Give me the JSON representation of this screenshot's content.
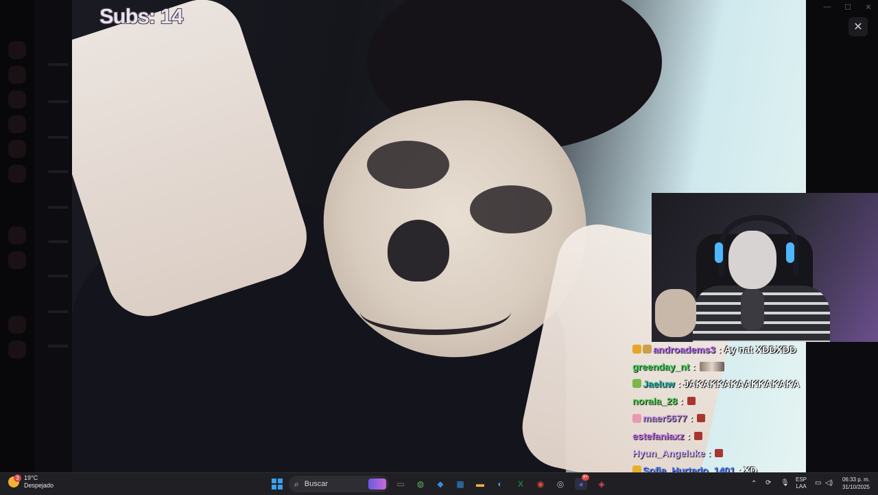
{
  "window": {
    "minimize_glyph": "—",
    "maximize_glyph": "☐",
    "close_glyph": "✕",
    "overlay_close_glyph": "✕"
  },
  "stream": {
    "subs_counter": "Subs: 14",
    "cursor_glyph": "🔍"
  },
  "chat": {
    "messages": [
      {
        "user": "androadems3",
        "user_color": "#b46cf0",
        "text": "Ay nat XDDXDD",
        "badges": [
          "#e7a52a",
          "#c9a04a"
        ]
      },
      {
        "user": "greenday_nt",
        "user_color": "#39d353",
        "text": "",
        "emote": "wide"
      },
      {
        "user": "Jaeluw",
        "user_color": "#1fb6a6",
        "text": "JAKAKKAKAAKKAKAKA",
        "badges": [
          "#7ab84a"
        ]
      },
      {
        "user": "norala_28",
        "user_color": "#4fd14f",
        "text": "",
        "emote": "small"
      },
      {
        "user": "maer5677",
        "user_color": "#c08ce8",
        "text": "",
        "emote": "small",
        "badges": [
          "#e79ab0"
        ]
      },
      {
        "user": "estefaniaxz",
        "user_color": "#c46cf0",
        "text": "",
        "emote": "small"
      },
      {
        "user": "Hyun_Angeluke",
        "user_color": "#d7b8ff",
        "text": "",
        "emote": "small"
      },
      {
        "user": "Sofia_Hurtado_1401",
        "user_color": "#4d7cff",
        "text": "XD",
        "badges": [
          "#e7b02a"
        ]
      }
    ],
    "separator": ":"
  },
  "taskbar": {
    "weather_temp": "19°C",
    "weather_desc": "Despejado",
    "weather_badge": "3",
    "search_placeholder": "Buscar",
    "language_line1": "ESP",
    "language_line2": "LAA",
    "time": "06:33 p. m.",
    "date": "31/10/2025",
    "discord_badge": "9+",
    "apps": [
      {
        "name": "copilot-icon",
        "glyph": "✦",
        "color": "#7f6bd9"
      },
      {
        "name": "file-explorer-icon",
        "glyph": "▭",
        "color": "#7a7a80"
      },
      {
        "name": "app-green-icon",
        "glyph": "◍",
        "color": "#5bb35b"
      },
      {
        "name": "copilot-app-icon",
        "glyph": "◆",
        "color": "#2f8de0"
      },
      {
        "name": "store-icon",
        "glyph": "▦",
        "color": "#2e8fd6"
      },
      {
        "name": "folder-icon",
        "glyph": "▬",
        "color": "#e8b83a"
      },
      {
        "name": "edge-icon",
        "glyph": "◐",
        "color": "#2fb0c8"
      },
      {
        "name": "excel-icon",
        "glyph": "X",
        "color": "#1f7a45"
      },
      {
        "name": "chrome-icon",
        "glyph": "◉",
        "color": "#e04a3a"
      },
      {
        "name": "obs-icon",
        "glyph": "◎",
        "color": "#bdbdbd"
      },
      {
        "name": "discord-icon",
        "glyph": "◕",
        "color": "#5865f2"
      },
      {
        "name": "app-extra-icon",
        "glyph": "◈",
        "color": "#e04848"
      }
    ]
  }
}
